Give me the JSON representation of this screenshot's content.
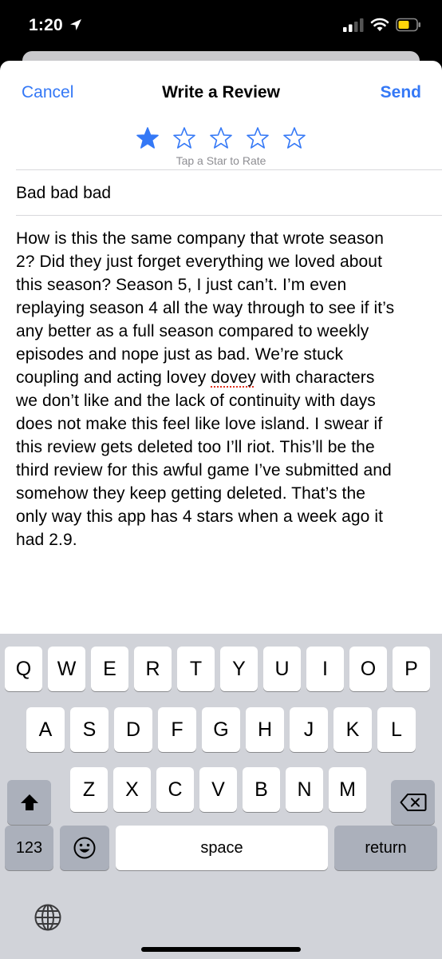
{
  "status": {
    "time": "1:20"
  },
  "nav": {
    "cancel": "Cancel",
    "title": "Write a Review",
    "send": "Send"
  },
  "rating": {
    "value": 1,
    "max": 5,
    "hint": "Tap a Star to Rate",
    "color": "#3478f6"
  },
  "review": {
    "title": "Bad bad bad",
    "lines": [
      "How is this the same company that wrote season",
      "2? Did they just forget everything we loved about",
      "this season? Season 5, I just can’t. I’m even",
      "replaying season 4 all the way through to see if it’s",
      "any better as a full season compared to weekly",
      "episodes and nope just as bad. We’re stuck",
      "coupling and acting lovey dovey with characters",
      "we don’t like and the lack of continuity with days",
      "does not make this feel like love island. I swear if",
      "this review gets deleted too I’ll riot. This’ll be the",
      "third review for this awful game I’ve submitted and",
      "somehow they keep getting deleted. That’s the",
      "only way this app has 4 stars when a week ago it",
      "had 2.9."
    ]
  },
  "keyboard": {
    "row1": [
      "Q",
      "W",
      "E",
      "R",
      "T",
      "Y",
      "U",
      "I",
      "O",
      "P"
    ],
    "row2": [
      "A",
      "S",
      "D",
      "F",
      "G",
      "H",
      "J",
      "K",
      "L"
    ],
    "row3": [
      "Z",
      "X",
      "C",
      "V",
      "B",
      "N",
      "M"
    ],
    "numbers": "123",
    "space": "space",
    "return": "return"
  },
  "icons": [
    "location-arrow-icon",
    "signal-icon",
    "wifi-icon",
    "battery-icon",
    "star-filled-icon",
    "star-outline-icon",
    "shift-icon",
    "backspace-icon",
    "emoji-icon",
    "globe-icon"
  ]
}
